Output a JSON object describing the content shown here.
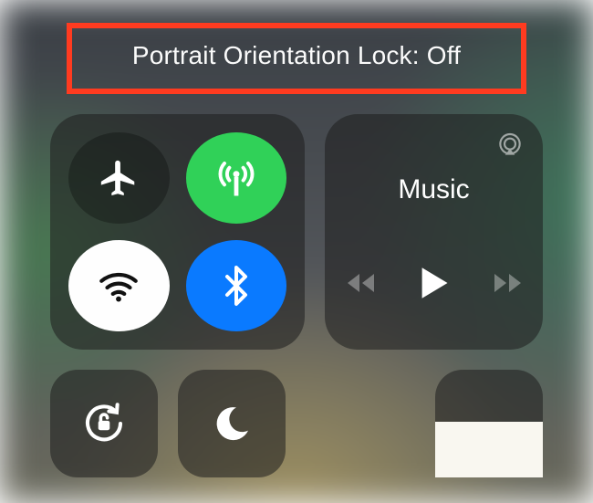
{
  "status": {
    "text": "Portrait Orientation Lock: Off"
  },
  "music": {
    "title": "Music"
  },
  "brightness": {
    "fill_percent": 52
  },
  "colors": {
    "highlight": "#ff3b20",
    "green": "#30d158",
    "blue": "#0a7aff"
  }
}
